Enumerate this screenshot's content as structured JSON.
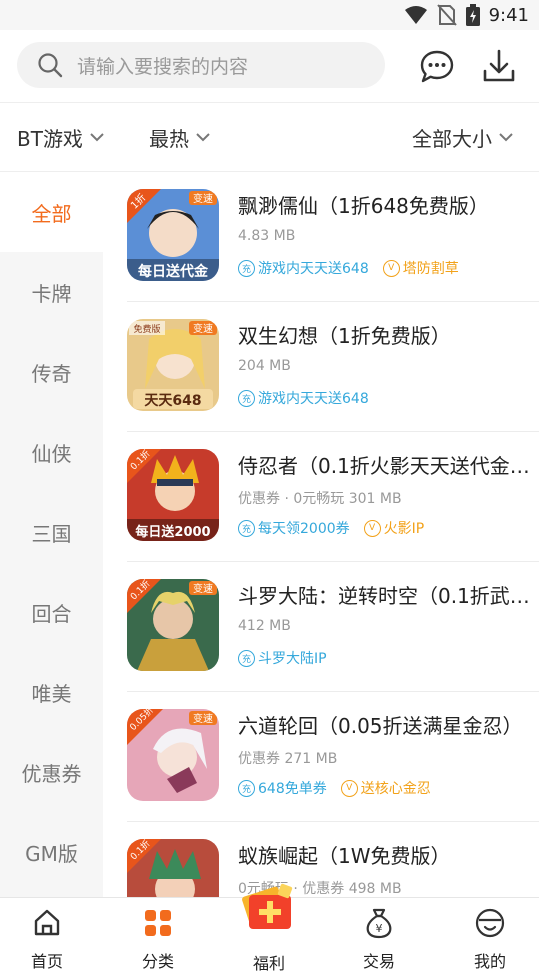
{
  "status_bar": {
    "time": "9:41"
  },
  "search": {
    "placeholder": "请输入要搜索的内容"
  },
  "filters": [
    {
      "label": "BT游戏"
    },
    {
      "label": "最热"
    },
    {
      "label": "全部大小"
    }
  ],
  "sidebar": {
    "active_index": 0,
    "items": [
      {
        "label": "全部"
      },
      {
        "label": "卡牌"
      },
      {
        "label": "传奇"
      },
      {
        "label": "仙侠"
      },
      {
        "label": "三国"
      },
      {
        "label": "回合"
      },
      {
        "label": "唯美"
      },
      {
        "label": "优惠券"
      },
      {
        "label": "GM版"
      }
    ]
  },
  "games": [
    {
      "title": "飘渺儒仙（1折648免费版）",
      "meta": "4.83 MB",
      "icon": {
        "corner": "1折",
        "flag": "变速",
        "banner": "每日送代金",
        "bg": "#5b8fd6"
      },
      "tags": [
        {
          "type": "c",
          "text": "游戏内天天送648"
        },
        {
          "type": "v",
          "text": "塔防割草"
        }
      ]
    },
    {
      "title": "双生幻想（1折免费版）",
      "meta": "204 MB",
      "icon": {
        "corner": "免费版",
        "flag": "变速",
        "banner": "天天648",
        "bg": "#e8c98a"
      },
      "tags": [
        {
          "type": "c",
          "text": "游戏内天天送648"
        }
      ]
    },
    {
      "title": "侍忍者（0.1折火影天天送代金…",
      "meta": "优惠券 · 0元畅玩  301 MB",
      "icon": {
        "corner": "0.1折",
        "flag": "",
        "banner": "每日送2000",
        "bg": "#c63b2b"
      },
      "tags": [
        {
          "type": "c",
          "text": "每天领2000券"
        },
        {
          "type": "v",
          "text": "火影IP"
        }
      ]
    },
    {
      "title": "斗罗大陆：逆转时空（0.1折武…",
      "meta": "412 MB",
      "icon": {
        "corner": "0.1折",
        "flag": "变速",
        "banner": "",
        "bg": "#3a6a4c"
      },
      "tags": [
        {
          "type": "c",
          "text": "斗罗大陆IP"
        }
      ]
    },
    {
      "title": "六道轮回（0.05折送满星金忍）",
      "meta": "优惠券  271 MB",
      "icon": {
        "corner": "0.05折",
        "flag": "变速",
        "banner": "",
        "bg": "#e6a6b8"
      },
      "tags": [
        {
          "type": "c",
          "text": "648免单券"
        },
        {
          "type": "v",
          "text": "送核心金忍"
        }
      ]
    },
    {
      "title": "蚁族崛起（1W免费版）",
      "meta": "0元畅玩 · 优惠券  498 MB",
      "icon": {
        "corner": "0.1折",
        "flag": "",
        "banner": "",
        "bg": "#b84c3c"
      },
      "tags": []
    }
  ],
  "bottom_nav": [
    {
      "label": "首页",
      "icon": "home-icon"
    },
    {
      "label": "分类",
      "icon": "grid-icon"
    },
    {
      "label": "福利",
      "icon": "gift-icon"
    },
    {
      "label": "交易",
      "icon": "money-bag-icon"
    },
    {
      "label": "我的",
      "icon": "user-icon"
    }
  ],
  "colors": {
    "accent": "#f26b1d",
    "tag_blue": "#35a8db",
    "tag_gold": "#f2a21a"
  }
}
